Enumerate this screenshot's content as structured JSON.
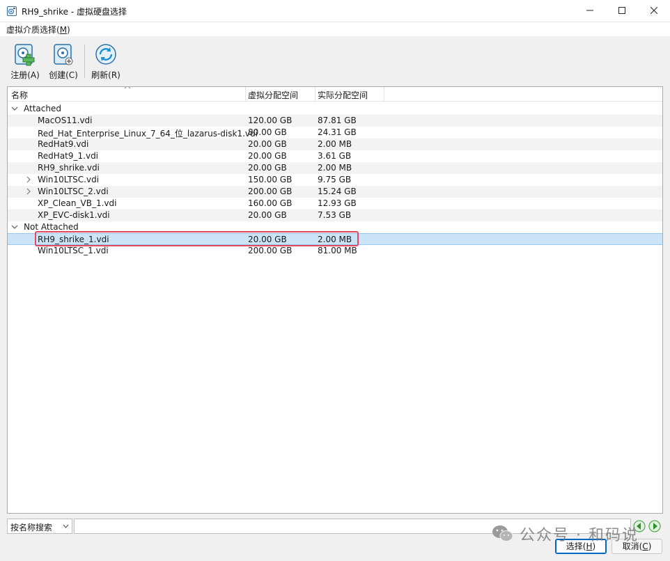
{
  "window": {
    "title": "RH9_shrike - 虚拟硬盘选择",
    "icon": "disk-select-icon"
  },
  "menu": {
    "label": "虚拟介质选择(",
    "accel": "M",
    "suffix": ")"
  },
  "toolbar": {
    "register_label": "注册(A)",
    "create_label": "创建(C)",
    "refresh_label": "刷新(R)"
  },
  "table": {
    "columns": {
      "name": "名称",
      "virtual_size": "虚拟分配空间",
      "actual_size": "实际分配空间"
    },
    "groups": [
      {
        "label": "Attached",
        "expanded": true,
        "items": [
          {
            "name": "MacOS11.vdi",
            "virtual": "120.00 GB",
            "actual": "87.81 GB",
            "expandable": false
          },
          {
            "name": "Red_Hat_Enterprise_Linux_7_64_位_lazarus-disk1.vdi",
            "virtual": "80.00 GB",
            "actual": "24.31 GB",
            "expandable": false
          },
          {
            "name": "RedHat9.vdi",
            "virtual": "20.00 GB",
            "actual": "2.00 MB",
            "expandable": false
          },
          {
            "name": "RedHat9_1.vdi",
            "virtual": "20.00 GB",
            "actual": "3.61 GB",
            "expandable": false
          },
          {
            "name": "RH9_shrike.vdi",
            "virtual": "20.00 GB",
            "actual": "2.00 MB",
            "expandable": false
          },
          {
            "name": "Win10LTSC.vdi",
            "virtual": "150.00 GB",
            "actual": "9.75 GB",
            "expandable": true
          },
          {
            "name": "Win10LTSC_2.vdi",
            "virtual": "200.00 GB",
            "actual": "15.24 GB",
            "expandable": true
          },
          {
            "name": "XP_Clean_VB_1.vdi",
            "virtual": "160.00 GB",
            "actual": "12.93 GB",
            "expandable": false
          },
          {
            "name": "XP_EVC-disk1.vdi",
            "virtual": "20.00 GB",
            "actual": "7.53 GB",
            "expandable": false
          }
        ]
      },
      {
        "label": "Not Attached",
        "expanded": true,
        "items": [
          {
            "name": "RH9_shrike_1.vdi",
            "virtual": "20.00 GB",
            "actual": "2.00 MB",
            "expandable": false,
            "selected": true
          },
          {
            "name": "Win10LTSC_1.vdi",
            "virtual": "200.00 GB",
            "actual": "81.00 MB",
            "expandable": false
          }
        ]
      }
    ]
  },
  "search": {
    "mode": "按名称搜索",
    "value": ""
  },
  "buttons": {
    "choose_label": "选择(",
    "choose_accel": "H",
    "cancel_label": "取消(",
    "cancel_accel": "C",
    "suffix": ")"
  },
  "watermark": {
    "text": "公众号 · 和码说"
  },
  "colors": {
    "selected_row": "#cce4f7",
    "highlight_border": "#e2475f",
    "alt_row": "#f3f3f3",
    "default_button_border": "#0067c0"
  }
}
